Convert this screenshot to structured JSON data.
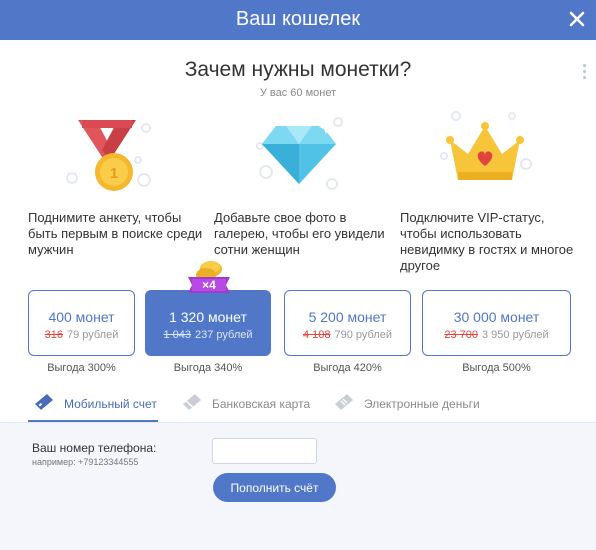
{
  "window": {
    "title": "Ваш кошелек"
  },
  "intro": {
    "heading": "Зачем нужны монетки?",
    "balance": "У вас 60 монет"
  },
  "features": [
    {
      "icon": "medal-icon",
      "text": "Поднимите анкету, чтобы быть первым в поиске среди мужчин"
    },
    {
      "icon": "diamond-icon",
      "text": "Добавьте свое фото в галерею, чтобы его увидели сотни женщин"
    },
    {
      "icon": "crown-icon",
      "text": "Подключите VIP-статус, чтобы использовать невидимку в гостях и многое другое"
    }
  ],
  "packages": [
    {
      "amount": "400 монет",
      "old_price": "316",
      "price": "79 рублей",
      "benefit": "Выгода 300%",
      "selected": false
    },
    {
      "amount": "1 320 монет",
      "old_price": "1 043",
      "price": "237 рублей",
      "benefit": "Выгода 340%",
      "selected": true,
      "badge": "×4"
    },
    {
      "amount": "5 200 монет",
      "old_price": "4 108",
      "price": "790 рублей",
      "benefit": "Выгода 420%",
      "selected": false
    },
    {
      "amount": "30 000 монет",
      "old_price": "23 700",
      "price": "3 950 рублей",
      "benefit": "Выгода 500%",
      "selected": false
    }
  ],
  "tabs": [
    {
      "label": "Мобильный счет",
      "icon": "mobile-payment-icon",
      "active": true
    },
    {
      "label": "Банковская карта",
      "icon": "bank-card-icon",
      "active": false
    },
    {
      "label": "Электронные деньги",
      "icon": "e-money-icon",
      "active": false
    }
  ],
  "form": {
    "phone_label": "Ваш номер телефона:",
    "phone_hint": "например: +79123344555",
    "phone_value": "",
    "submit_label": "Пополнить счёт"
  },
  "colors": {
    "accent": "#5177c8",
    "old_price": "#e0453d",
    "form_bg": "#f4f6fb"
  }
}
